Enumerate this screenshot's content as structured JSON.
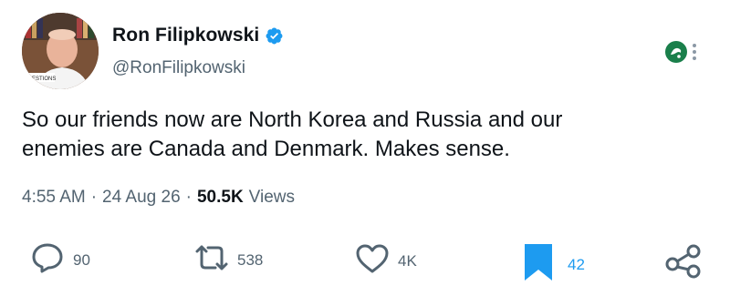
{
  "author": {
    "display_name": "Ron Filipkowski",
    "handle": "@RonFilipkowski",
    "verified": true,
    "avatar_caption": "QUESTIONS"
  },
  "tweet": {
    "text_line1": "So our friends now are North Korea and Russia and our",
    "text_line2": "enemies are Canada and Denmark. Makes sense."
  },
  "meta": {
    "time": "4:55 AM",
    "separator": "·",
    "date": "24 Aug 26",
    "views_count": "50.5K",
    "views_label": "Views"
  },
  "actions": {
    "replies": "90",
    "reposts": "538",
    "likes": "4K",
    "bookmarks": "42",
    "bookmarked": true
  },
  "colors": {
    "accent": "#1d9bf0",
    "text": "#0f1419",
    "secondary": "#536471",
    "grok_badge": "#1a7f4b"
  }
}
